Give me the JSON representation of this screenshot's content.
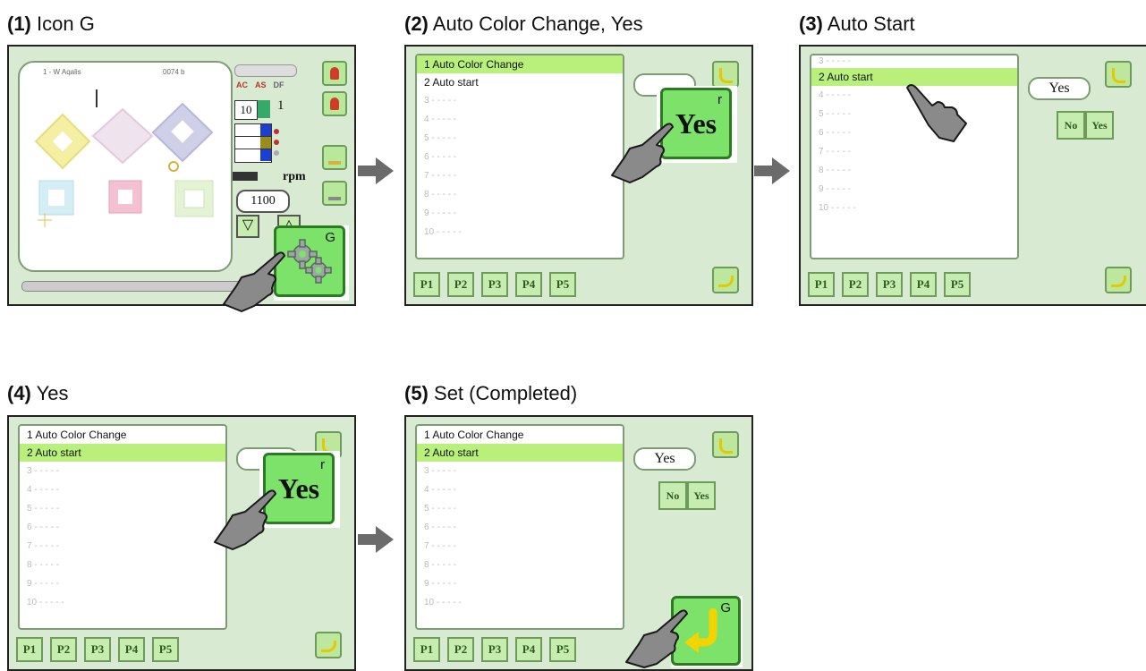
{
  "steps": [
    {
      "num": "(1)",
      "label": "Icon G"
    },
    {
      "num": "(2)",
      "label": "Auto Color Change, Yes"
    },
    {
      "num": "(3)",
      "label": "Auto Start"
    },
    {
      "num": "(4)",
      "label": "Yes"
    },
    {
      "num": "(5)",
      "label": "Set (Completed)"
    }
  ],
  "menu": {
    "item1": "1 Auto Color Change",
    "item2": "2 Auto start",
    "placeholders": [
      "3 - - - - -",
      "4 - - - - -",
      "5 - - - - -",
      "6 - - - - -",
      "7 - - - - -",
      "8 - - - - -",
      "9 - - - - -",
      "10 - - - - -"
    ]
  },
  "pages": [
    "P1",
    "P2",
    "P3",
    "P4",
    "P5"
  ],
  "buttons": {
    "yes": "Yes",
    "no": "No",
    "yes_big": "Yes",
    "corner_r": "r",
    "corner_g": "G"
  },
  "main_screen": {
    "header_left": "1 - W Aqalis",
    "header_right": "0074 b",
    "needle_box": "10",
    "count": "1",
    "rpm_label": "rpm",
    "speed": "1100",
    "indicators": [
      "AC",
      "AS",
      "DF"
    ]
  },
  "colors": {
    "screen_bg": "#d8ead2",
    "selection": "#b9f07c",
    "button_green": "#7de26a",
    "arrow_gray": "#6b6b6b"
  }
}
